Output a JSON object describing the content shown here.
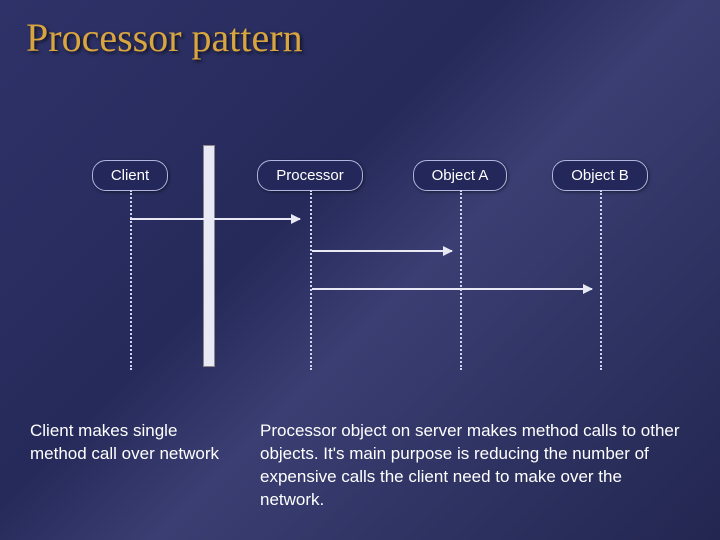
{
  "title": "Processor pattern",
  "lifelines": {
    "client": {
      "label": "Client"
    },
    "processor": {
      "label": "Processor"
    },
    "objectA": {
      "label": "Object A"
    },
    "objectB": {
      "label": "Object B"
    }
  },
  "captions": {
    "left": "Client makes single method call over network",
    "right": "Processor object on server makes method calls to other objects. It's main purpose is reducing the number of  expensive calls the client need to make over the network."
  },
  "chart_data": {
    "type": "diagram",
    "pattern": "sequence",
    "participants": [
      "Client",
      "Processor",
      "Object A",
      "Object B"
    ],
    "messages": [
      {
        "from": "Client",
        "to": "Processor",
        "order": 1
      },
      {
        "from": "Processor",
        "to": "Object A",
        "order": 2
      },
      {
        "from": "Processor",
        "to": "Object B",
        "order": 3
      }
    ]
  }
}
